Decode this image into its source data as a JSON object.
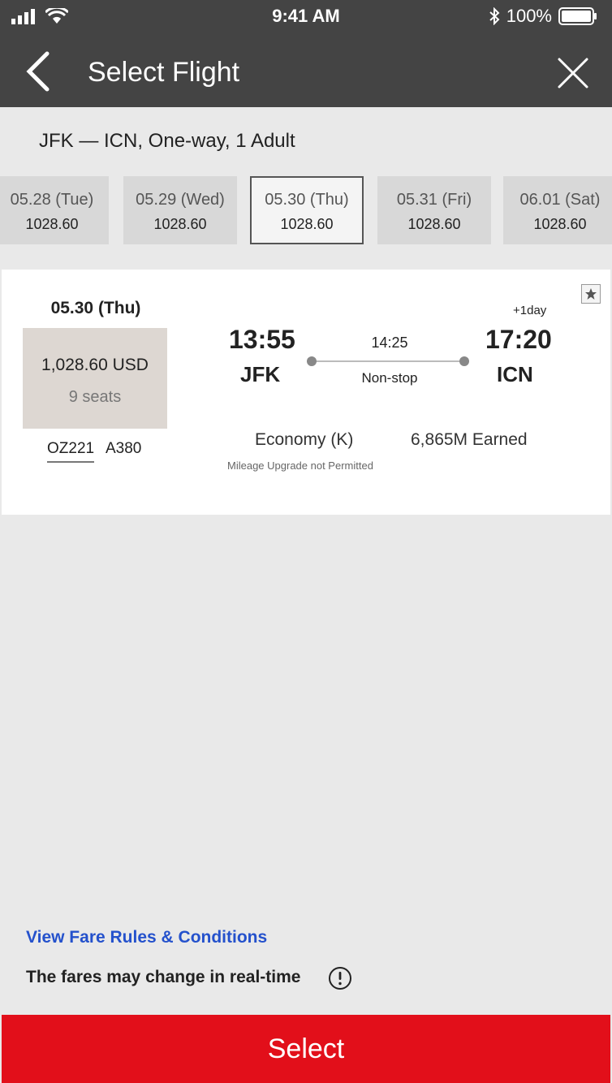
{
  "status_bar": {
    "time": "9:41 AM",
    "battery": "100%"
  },
  "nav": {
    "title": "Select Flight"
  },
  "route_summary": "JFK — ICN, One-way, 1 Adult",
  "dates": [
    {
      "label": "05.28 (Tue)",
      "price": "1028.60",
      "selected": false
    },
    {
      "label": "05.29 (Wed)",
      "price": "1028.60",
      "selected": false
    },
    {
      "label": "05.30 (Thu)",
      "price": "1028.60",
      "selected": true
    },
    {
      "label": "05.31 (Fri)",
      "price": "1028.60",
      "selected": false
    },
    {
      "label": "06.01 (Sat)",
      "price": "1028.60",
      "selected": false
    }
  ],
  "flight": {
    "date": "05.30 (Thu)",
    "price": "1,028.60 USD",
    "seats": "9 seats",
    "flight_number": "OZ221",
    "aircraft": "A380",
    "departure_time": "13:55",
    "departure_airport": "JFK",
    "arrival_time": "17:20",
    "arrival_airport": "ICN",
    "day_offset": "+1day",
    "duration": "14:25",
    "stops": "Non-stop",
    "cabin": "Economy (K)",
    "miles": "6,865M Earned",
    "upgrade_note": "Mileage Upgrade not Permitted"
  },
  "footer": {
    "fare_rules_link": "View Fare Rules & Conditions",
    "fare_note": "The fares may change in real-time",
    "select_label": "Select"
  },
  "colors": {
    "header": "#444444",
    "accent": "#e20f1a",
    "link": "#2451cc"
  }
}
